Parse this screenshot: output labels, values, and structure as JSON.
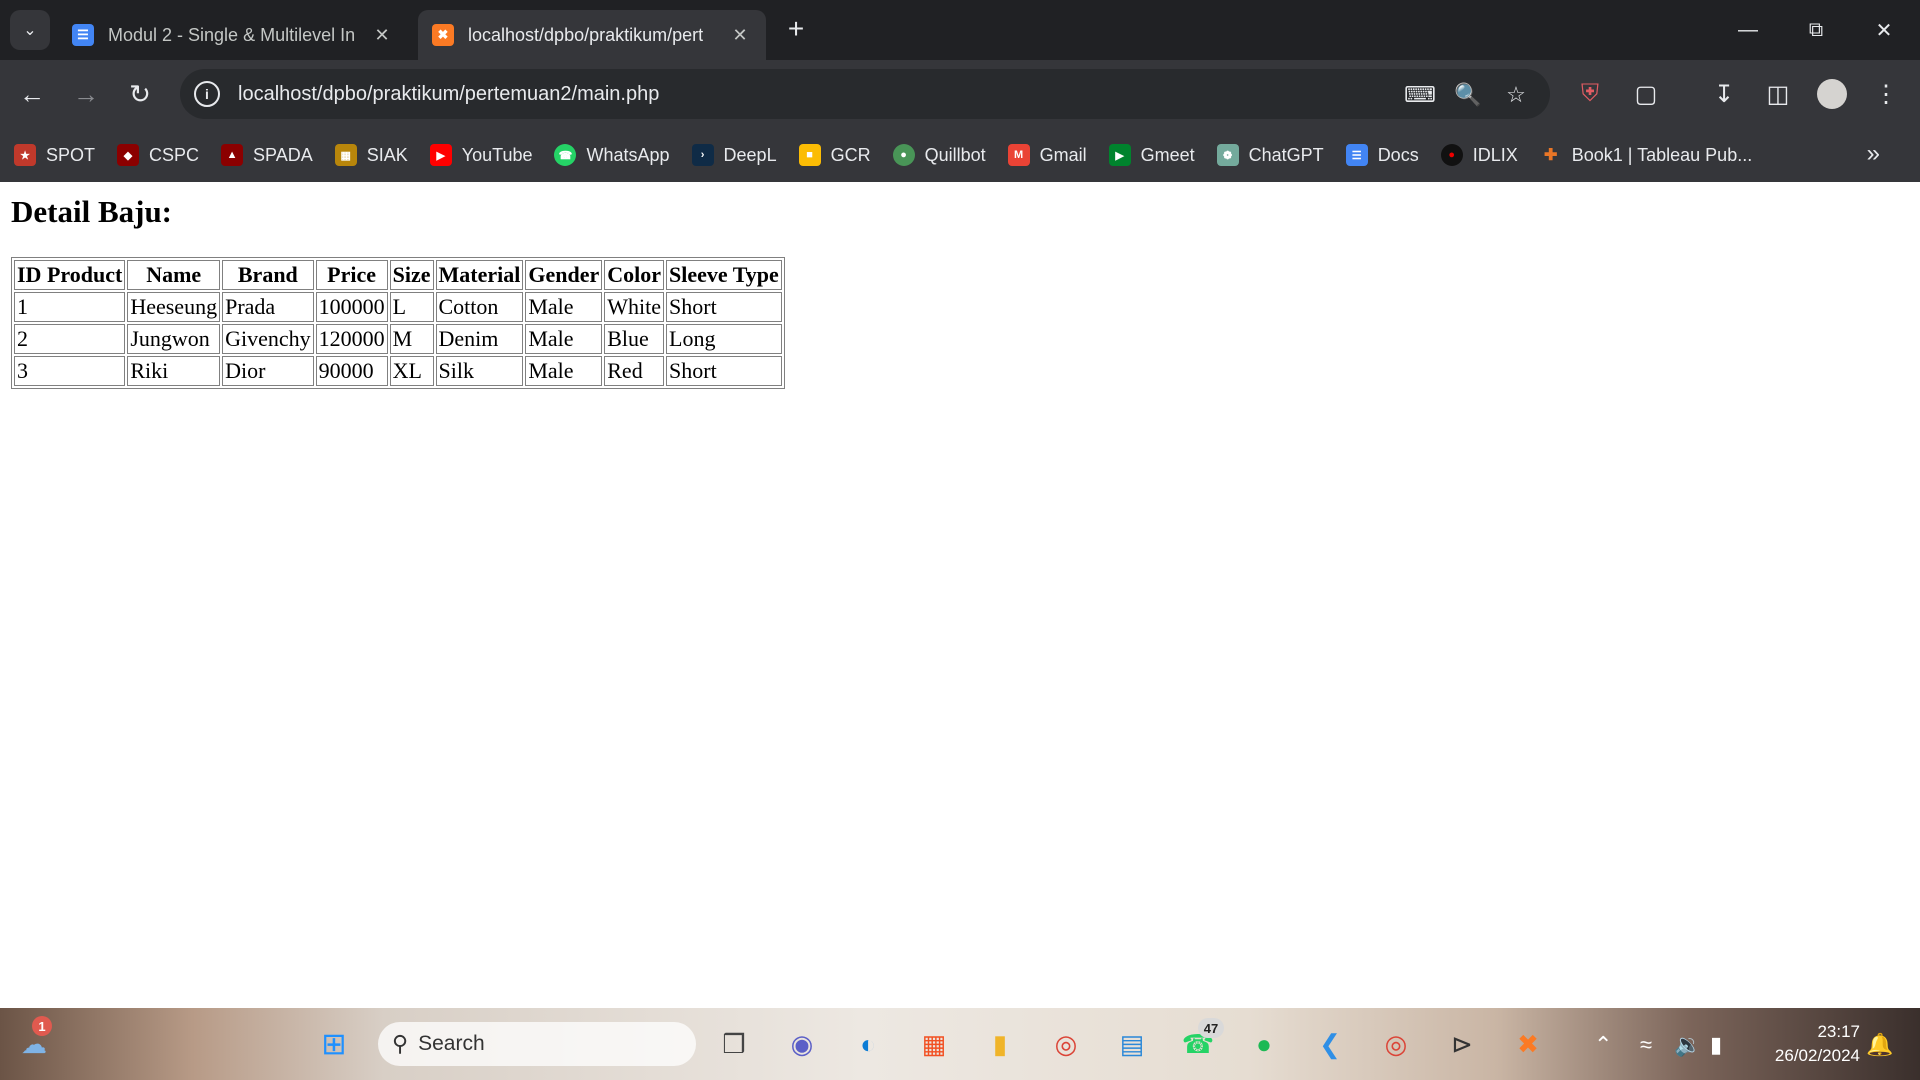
{
  "browser": {
    "tabs": [
      {
        "title": "Modul 2 - Single & Multilevel In",
        "icon": "docs-icon",
        "color": "#4285f4"
      },
      {
        "title": "localhost/dpbo/praktikum/pert",
        "icon": "xampp-icon",
        "color": "#fb7a24"
      }
    ],
    "new_tab": "+",
    "window_controls": [
      "minimize",
      "restore",
      "close"
    ],
    "address_bar": {
      "url": "localhost/dpbo/praktikum/pertemuan2/main.php"
    },
    "bookmarks": [
      {
        "label": "SPOT",
        "color": "#c0392b"
      },
      {
        "label": "CSPC",
        "color": "#8b0000"
      },
      {
        "label": "SPADA",
        "color": "#8b0000"
      },
      {
        "label": "SIAK",
        "color": "#b8860b"
      },
      {
        "label": "YouTube",
        "color": "#ff0000"
      },
      {
        "label": "WhatsApp",
        "color": "#25d366"
      },
      {
        "label": "DeepL",
        "color": "#0f2b46"
      },
      {
        "label": "GCR",
        "color": "#fbbc04"
      },
      {
        "label": "Quillbot",
        "color": "#499557"
      },
      {
        "label": "Gmail",
        "color": "#ea4335"
      },
      {
        "label": "Gmeet",
        "color": "#00832d"
      },
      {
        "label": "ChatGPT",
        "color": "#74aa9c"
      },
      {
        "label": "Docs",
        "color": "#4285f4"
      },
      {
        "label": "IDLIX",
        "color": "#111111"
      },
      {
        "label": "Book1 | Tableau Pub...",
        "color": "#e97627"
      }
    ]
  },
  "page": {
    "heading": "Detail Baju:",
    "table": {
      "headers": [
        "ID Product",
        "Name",
        "Brand",
        "Price",
        "Size",
        "Material",
        "Gender",
        "Color",
        "Sleeve Type"
      ],
      "rows": [
        [
          "1",
          "Heeseung",
          "Prada",
          "100000",
          "L",
          "Cotton",
          "Male",
          "White",
          "Short"
        ],
        [
          "2",
          "Jungwon",
          "Givenchy",
          "120000",
          "M",
          "Denim",
          "Male",
          "Blue",
          "Long"
        ],
        [
          "3",
          "Riki",
          "Dior",
          "90000",
          "XL",
          "Silk",
          "Male",
          "Red",
          "Short"
        ]
      ]
    }
  },
  "taskbar": {
    "weather_badge": "1",
    "search_placeholder": "Search",
    "whatsapp_badge": "47",
    "time": "23:17",
    "date": "26/02/2024"
  }
}
